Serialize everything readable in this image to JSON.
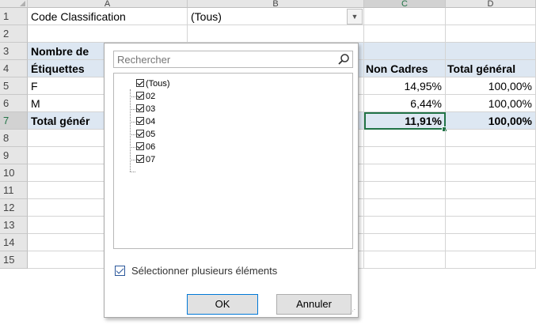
{
  "columns": [
    "A",
    "B",
    "C",
    "D"
  ],
  "rows": [
    "1",
    "2",
    "3",
    "4",
    "5",
    "6",
    "7",
    "8",
    "9",
    "10",
    "11",
    "12",
    "13",
    "14",
    "15"
  ],
  "cells": {
    "a1": "Code Classification",
    "b1": "(Tous)",
    "a3": "Nombre de",
    "a4": "Étiquettes",
    "c4": "Non Cadres",
    "d4": "Total général",
    "a5": "F",
    "c5": "14,95%",
    "d5": "100,00%",
    "a6": "M",
    "c6": "6,44%",
    "d6": "100,00%",
    "a7": "Total génér",
    "c7": "11,91%",
    "d7": "100,00%"
  },
  "filter_popup": {
    "search_placeholder": "Rechercher",
    "items": [
      "(Tous)",
      "02",
      "03",
      "04",
      "05",
      "06",
      "07"
    ],
    "multi_select_label": "Sélectionner plusieurs éléments",
    "ok_label": "OK",
    "cancel_label": "Annuler"
  },
  "icons": {
    "search": "search-icon",
    "dropdown": "dropdown-arrow-icon",
    "checkbox": "checkbox-checked-icon"
  },
  "colors": {
    "excel_green": "#217346",
    "header_band": "#dde7f2",
    "checkbox_blue": "#2b579a"
  }
}
